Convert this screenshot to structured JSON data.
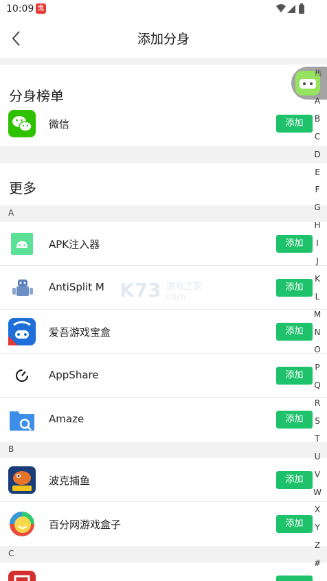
{
  "status_bar": {
    "time": "10:09",
    "app_icon_char": "鬼"
  },
  "header": {
    "title": "添加分身"
  },
  "ranking": {
    "heading": "分身榜单",
    "apps": [
      {
        "name": "微信",
        "action": "添加"
      }
    ]
  },
  "more": {
    "heading": "更多",
    "groups": [
      {
        "letter": "A",
        "apps": [
          {
            "name": "APK注入器",
            "action": "添加"
          },
          {
            "name": "AntiSplit M",
            "action": "添加"
          },
          {
            "name": "爱吾游戏宝盒",
            "action": "添加"
          },
          {
            "name": "AppShare",
            "action": "添加"
          },
          {
            "name": "Amaze",
            "action": "添加"
          }
        ]
      },
      {
        "letter": "B",
        "apps": [
          {
            "name": "波克捕鱼",
            "action": "添加"
          },
          {
            "name": "百分网游戏盒子",
            "action": "添加"
          }
        ]
      },
      {
        "letter": "C",
        "apps": []
      }
    ]
  },
  "float_bubble": {
    "label": "热"
  },
  "alphabet_index": [
    "A",
    "B",
    "C",
    "D",
    "E",
    "F",
    "G",
    "H",
    "I",
    "J",
    "K",
    "L",
    "M",
    "N",
    "O",
    "P",
    "Q",
    "R",
    "S",
    "T",
    "U",
    "V",
    "W",
    "X",
    "Y",
    "Z",
    "#"
  ],
  "watermark": {
    "brand": "K73",
    "text": "游戏之家",
    "domain": ".com"
  },
  "colors": {
    "accent": "#1ec26a",
    "background": "#f2f2f2"
  }
}
